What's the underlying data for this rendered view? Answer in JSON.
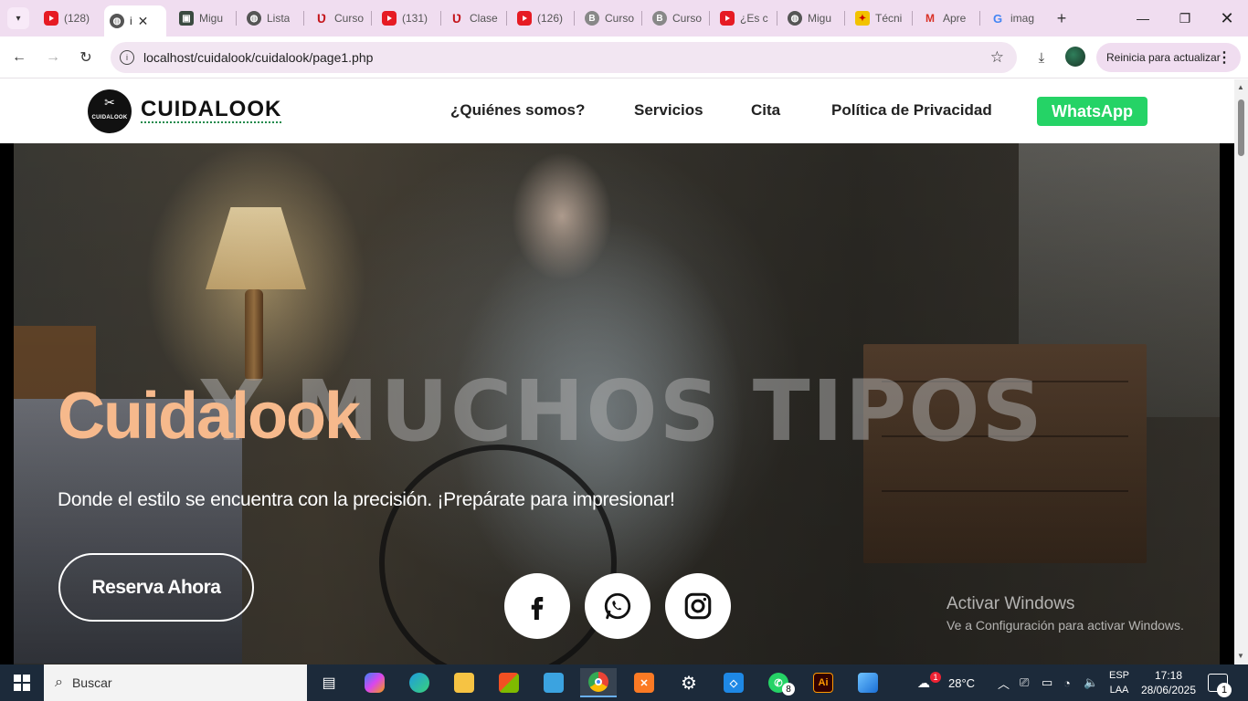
{
  "browser": {
    "tabs": [
      {
        "title": "(128)",
        "icon": "youtube-icon"
      },
      {
        "title": "i",
        "icon": "globe-icon",
        "active": true
      },
      {
        "title": "Migu",
        "icon": "image-icon"
      },
      {
        "title": "Lista",
        "icon": "globe-icon"
      },
      {
        "title": "Curso",
        "icon": "udemy-icon"
      },
      {
        "title": "(131)",
        "icon": "youtube-icon"
      },
      {
        "title": "Clase",
        "icon": "udemy-icon"
      },
      {
        "title": "(126)",
        "icon": "youtube-icon"
      },
      {
        "title": "Curso",
        "icon": "b-icon"
      },
      {
        "title": "Curso",
        "icon": "b-icon"
      },
      {
        "title": "¿Es c",
        "icon": "youtube-icon"
      },
      {
        "title": "Migu",
        "icon": "globe-icon"
      },
      {
        "title": "Técni",
        "icon": "flag-icon"
      },
      {
        "title": "Apre",
        "icon": "gmail-icon"
      },
      {
        "title": "imag",
        "icon": "google-icon"
      }
    ],
    "url": "localhost/cuidalook/cuidalook/page1.php",
    "update_label": "Reinicia para actualizar"
  },
  "site": {
    "brand": "CUIDALOOK",
    "logo_text": "CUIDALOOK",
    "nav": [
      "¿Quiénes somos?",
      "Servicios",
      "Cita",
      "Política de Privacidad"
    ],
    "whatsapp_label": "WhatsApp",
    "hero": {
      "background_word": "Y MUCHOS TIPOS",
      "title": "Cuidalook",
      "subtitle": "Donde el estilo se encuentra con la precisión. ¡Prepárate para impresionar!",
      "cta": "Reserva Ahora",
      "social": [
        "facebook-icon",
        "whatsapp-icon",
        "instagram-icon"
      ],
      "title_color": "#f6b98c"
    }
  },
  "watermark": {
    "line1": "Activar Windows",
    "line2": "Ve a Configuración para activar Windows."
  },
  "taskbar": {
    "search_placeholder": "Buscar",
    "whatsapp_badge": "8",
    "weather_badge": "1",
    "temperature": "28°C",
    "lang_1": "ESP",
    "lang_2": "LAA",
    "time": "17:18",
    "date": "28/06/2025",
    "notifications": "1"
  }
}
